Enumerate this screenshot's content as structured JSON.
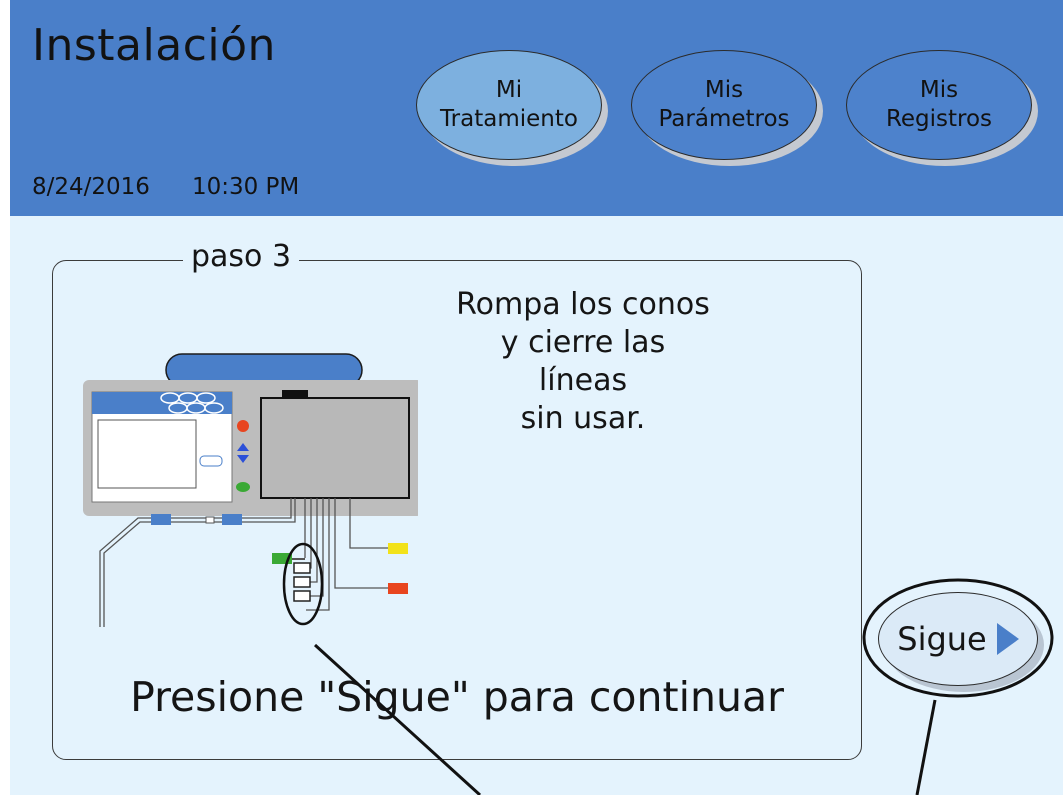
{
  "header": {
    "title": "Instalación",
    "date": "8/24/2016",
    "time": "10:30 PM"
  },
  "nav": {
    "tratamiento": [
      "Mi",
      "Tratamiento"
    ],
    "parametros": [
      "Mis",
      "Parámetros"
    ],
    "registros": [
      "Mis",
      "Registros"
    ],
    "selected": "tratamiento"
  },
  "step": {
    "legend": "paso 3",
    "instruction": [
      "Rompa los conos",
      "y cierre las líneas",
      "sin usar."
    ],
    "hint": "Presione \"Sigue\" para continuar"
  },
  "sigue_button": {
    "label": "Sigue",
    "arrow_icon": "play-arrow-icon"
  },
  "colors": {
    "header_bg": "#4a7fc9",
    "screen_bg": "#e4f3fd",
    "selected_button": "#7db0df",
    "clamp_green": "#3aa935",
    "clamp_yellow": "#f2e21a",
    "clamp_red": "#e8451f",
    "connector_blue": "#4a7fc9"
  }
}
